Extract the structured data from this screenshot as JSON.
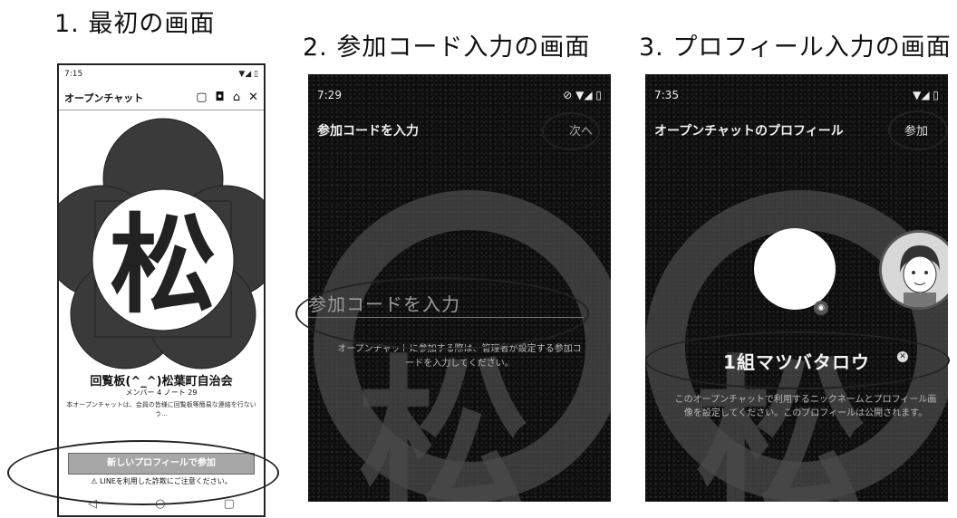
{
  "captions": {
    "step1": "1. 最初の画面",
    "step2": "2. 参加コード入力の画面",
    "step3": "3. プロフィール入力の画面"
  },
  "screen1": {
    "status": {
      "time": "7:15",
      "right": "▼◢ ▯"
    },
    "title": "オープンチャット",
    "icons": [
      "window-icon",
      "shield-icon",
      "bell-icon",
      "close-icon"
    ],
    "logo_text": "松",
    "room_name": "回覧板(^_^)松葉町自治会",
    "meta": "メンバー 4 ノート 29",
    "description": "本オープンチャットは、会員の皆様に回覧板等簡易な連絡を行ないう…",
    "join_button": "新しいプロフィールで参加",
    "note": "⚠ LINEを利用した詐欺にご注意ください。",
    "nav": [
      "◁",
      "○",
      "▢"
    ]
  },
  "screen2": {
    "status": {
      "time": "7:29",
      "right": "⊘ ▼◢ ▯"
    },
    "title": "参加コードを入力",
    "action": "次へ",
    "input_placeholder": "参加コードを入力",
    "help": "オープンチャットに参加する際は、管理者が設定する参加コードを入力してください。"
  },
  "screen3": {
    "status": {
      "time": "7:35",
      "right": "▼◢ ▯"
    },
    "title": "オープンチャットのプロフィール",
    "action": "参加",
    "name_value": "1組マツバタロウ",
    "help": "このオープンチャットで利用するニックネームとプロフィール画像を設定してください。このプロフィールは公開されます。"
  },
  "colors": {
    "dark_bg": "#0d0d0d",
    "deco_gray": "#4a4a4a",
    "join_button": "#a7a7a7"
  }
}
